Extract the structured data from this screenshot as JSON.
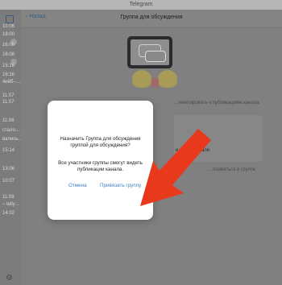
{
  "app": {
    "title": "Telegram"
  },
  "sidebar": {
    "rows": [
      {
        "text": "10:06"
      },
      {
        "text": "18:00",
        "badge": ""
      },
      {
        "text": "16:08"
      },
      {
        "text": "16:08",
        "badge": ""
      },
      {
        "text": "15:16"
      },
      {
        "text": "16:16"
      },
      {
        "text": "4ийб–…"
      },
      {
        "text": "11:07"
      },
      {
        "text": "11:07"
      },
      {
        "text": "11:06"
      },
      {
        "text": "стало…"
      },
      {
        "text": "вались…"
      },
      {
        "text": "15:14"
      },
      {
        "text": "13:06"
      },
      {
        "text": "10:07"
      },
      {
        "text": "11:08"
      },
      {
        "text": "– telly…"
      },
      {
        "text": "14:02"
      }
    ]
  },
  "header": {
    "back_label": "Назад",
    "title": "Группа для обсуждения"
  },
  "background": {
    "hint_text": "…ментировать к публикациям канала",
    "option_text": "и их привязали",
    "footer_text": "…появиться в группе"
  },
  "modal": {
    "text_1": "Назначить Группа для обсуждения группой для обсуждения?",
    "text_2": "Все участники группы смогут видеть публикации канала.",
    "cancel_label": "Отмена",
    "confirm_label": "Привязать группу"
  },
  "colors": {
    "accent": "#3d7fc3",
    "arrow": "#e8391d"
  }
}
